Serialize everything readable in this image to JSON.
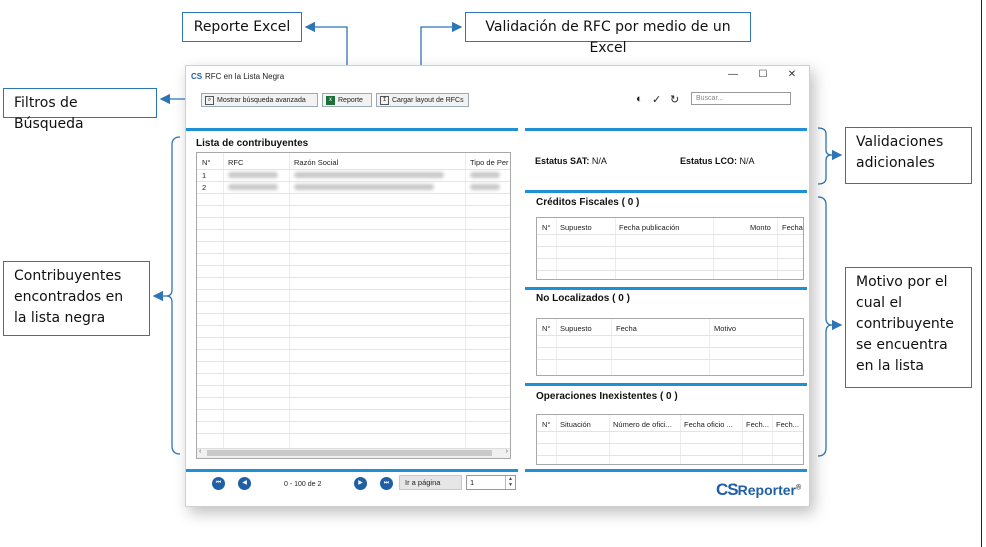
{
  "callouts": {
    "reporte_excel": "Reporte Excel",
    "validacion_rfc": "Validación de RFC por medio de un Excel",
    "filtros": "Filtros de Búsqueda",
    "validaciones": "Validaciones adicionales",
    "contribuyentes": "Contribuyentes encontrados en la lista negra",
    "motivo": "Motivo por el cual el contribuyente se encuentra en la lista"
  },
  "window": {
    "title": "RFC en la Lista Negra",
    "app_icon": "CS",
    "minimize": "—",
    "maximize": "☐",
    "close": "✕"
  },
  "toolbar": {
    "advanced_search": "Mostrar búsqueda avanzada",
    "report": "Reporte",
    "load_layout": "Cargar layout de RFCs",
    "search_placeholder": "Buscar..."
  },
  "contributors": {
    "title": "Lista de contribuyentes",
    "columns": [
      "N°",
      "RFC",
      "Razón Social",
      "Tipo de Per"
    ],
    "rows": [
      {
        "n": "1"
      },
      {
        "n": "2"
      }
    ]
  },
  "status": {
    "sat_label": "Estatus SAT:",
    "sat_value": "N/A",
    "lco_label": "Estatus LCO:",
    "lco_value": "N/A"
  },
  "creditos": {
    "title": "Créditos Fiscales ( 0 )",
    "columns": [
      "N°",
      "Supuesto",
      "Fecha publicación",
      "Monto",
      "Fecha"
    ]
  },
  "no_localizados": {
    "title": "No Localizados ( 0 )",
    "columns": [
      "N°",
      "Supuesto",
      "Fecha",
      "Motivo"
    ]
  },
  "operaciones": {
    "title": "Operaciones Inexistentes ( 0 )",
    "columns": [
      "N°",
      "Situación",
      "Número de ofici...",
      "Fecha oficio ...",
      "Fech...",
      "Fech..."
    ]
  },
  "pager": {
    "range": "0 - 100 de 2",
    "goto_label": "Ir a página",
    "page_value": "1"
  },
  "brand": {
    "cs": "CS",
    "name": "Reporter",
    "mark": "®"
  },
  "colors": {
    "accent": "#1f8fd6",
    "callout_border": "#2e75b6",
    "brand": "#1f5fa8"
  }
}
